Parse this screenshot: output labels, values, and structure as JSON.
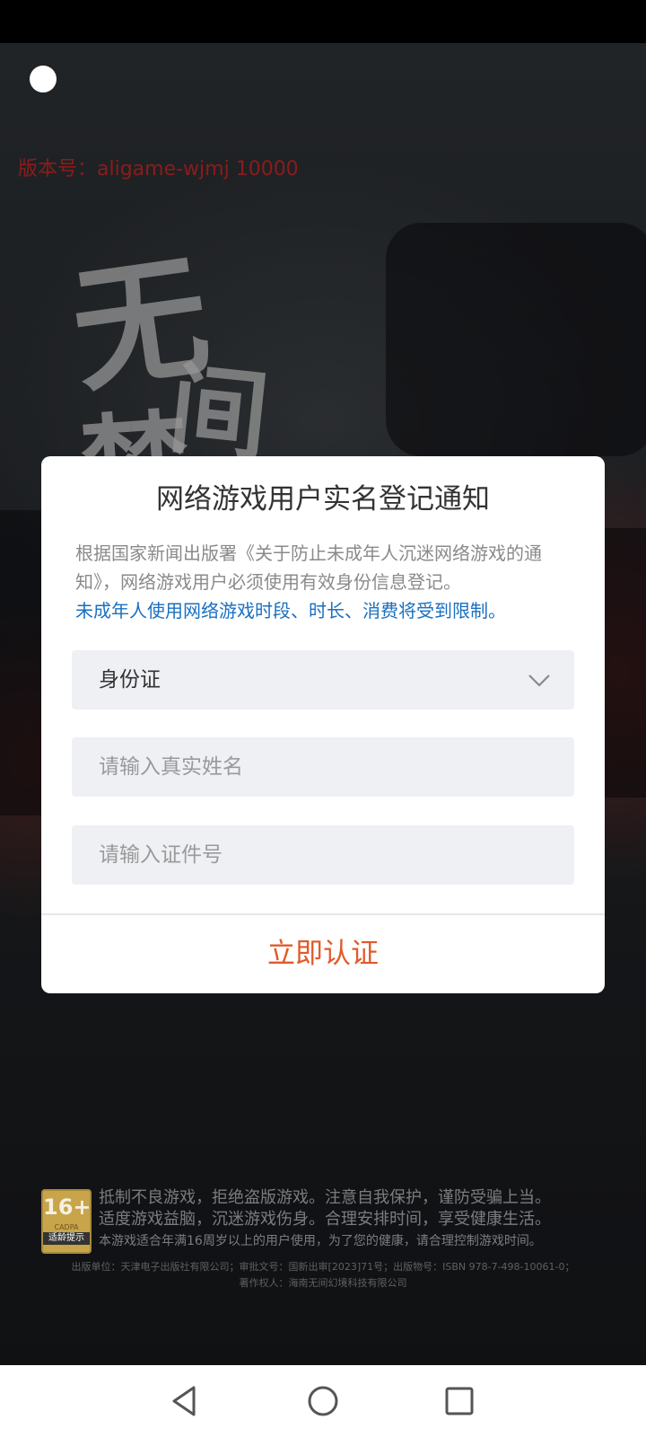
{
  "game": {
    "version_text": "版本号：aligame-wjmj 10000",
    "logo_icon": "game-title-calligraphy",
    "logo_chars": [
      "无",
      "间",
      "梦"
    ]
  },
  "dialog": {
    "title": "网络游戏用户实名登记通知",
    "notice": "根据国家新闻出版署《关于防止未成年人沉迷网络游戏的通知》，网络游戏用户必须使用有效身份信息登记。",
    "notice_highlight": "未成年人使用网络游戏时段、时长、消费将受到限制。",
    "id_type": {
      "selected": "身份证",
      "icon": "chevron-down-icon"
    },
    "name_field": {
      "placeholder": "请输入真实姓名",
      "value": ""
    },
    "id_field": {
      "placeholder": "请输入证件号",
      "value": ""
    },
    "submit_label": "立即认证"
  },
  "footer": {
    "age_rating": {
      "age": "16+",
      "org": "CADPA",
      "tip": "适龄提示"
    },
    "warning_line1": "抵制不良游戏，拒绝盗版游戏。注意自我保护，谨防受骗上当。",
    "warning_line2": "适度游戏益脑，沉迷游戏伤身。合理安排时间，享受健康生活。",
    "warning_line3": "本游戏适合年满16周岁以上的用户使用，为了您的健康，请合理控制游戏时间。",
    "publisher_line": "出版单位：天津电子出版社有限公司；审批文号：国新出审[2023]71号；出版物号：ISBN 978-7-498-10061-0；",
    "copyright_line": "著作权人：海南无间幻境科技有限公司"
  },
  "navbar": {
    "back_icon": "back-triangle-icon",
    "home_icon": "home-circle-icon",
    "recents_icon": "recents-square-icon"
  },
  "colors": {
    "accent_orange": "#e05a2b",
    "link_blue": "#1a6fc0",
    "version_red": "#8a1c1c"
  }
}
